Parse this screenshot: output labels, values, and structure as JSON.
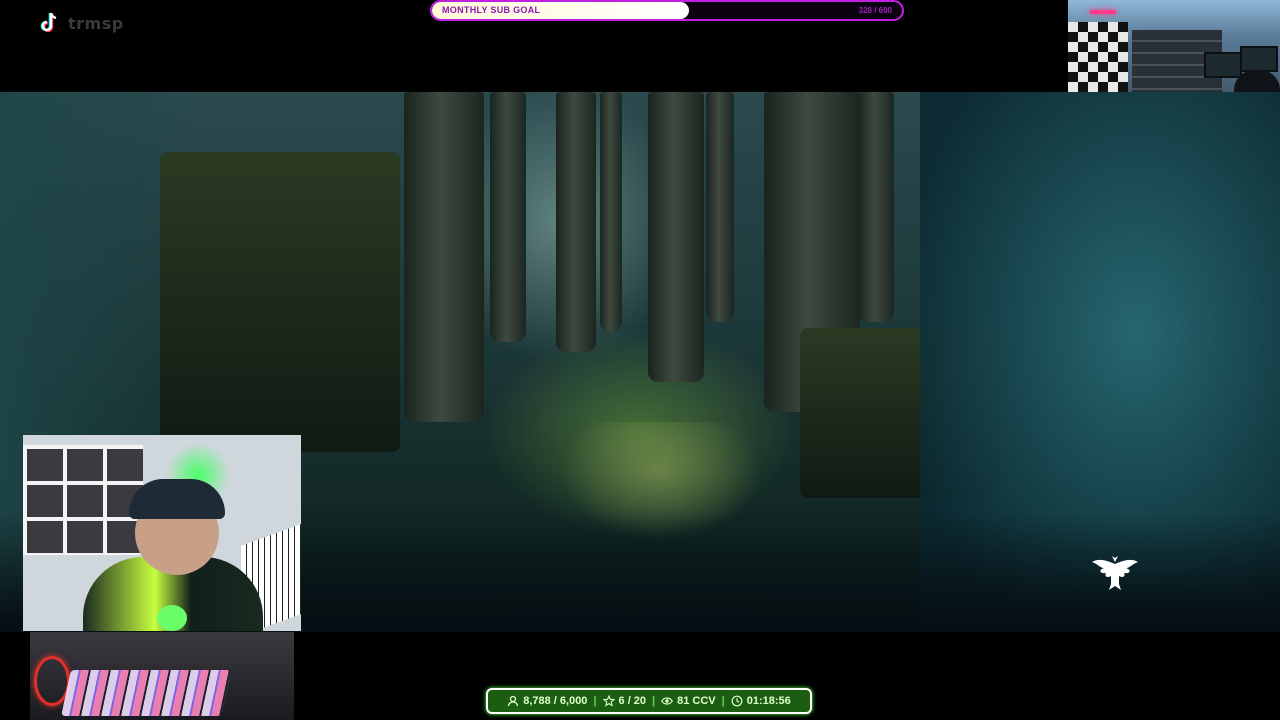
{
  "brand": {
    "name": "trmsp",
    "icon": "tiktok-icon"
  },
  "sub_goal": {
    "label": "MONTHLY SUB GOAL",
    "count_text": "328 / 600",
    "current": 328,
    "target": 600
  },
  "stats": {
    "followers": "8,788 / 6,000",
    "stars": "6 / 20",
    "viewers": "81 CCV",
    "uptime": "01:18:56"
  },
  "icons": [
    "tiktok-icon",
    "user-icon",
    "star-icon",
    "eye-icon",
    "clock-icon",
    "eagle-logo-icon"
  ],
  "colors": {
    "goal_border": "#c020e0",
    "stats_bg": "#1b5e12",
    "accent_green": "#4aff4a"
  }
}
